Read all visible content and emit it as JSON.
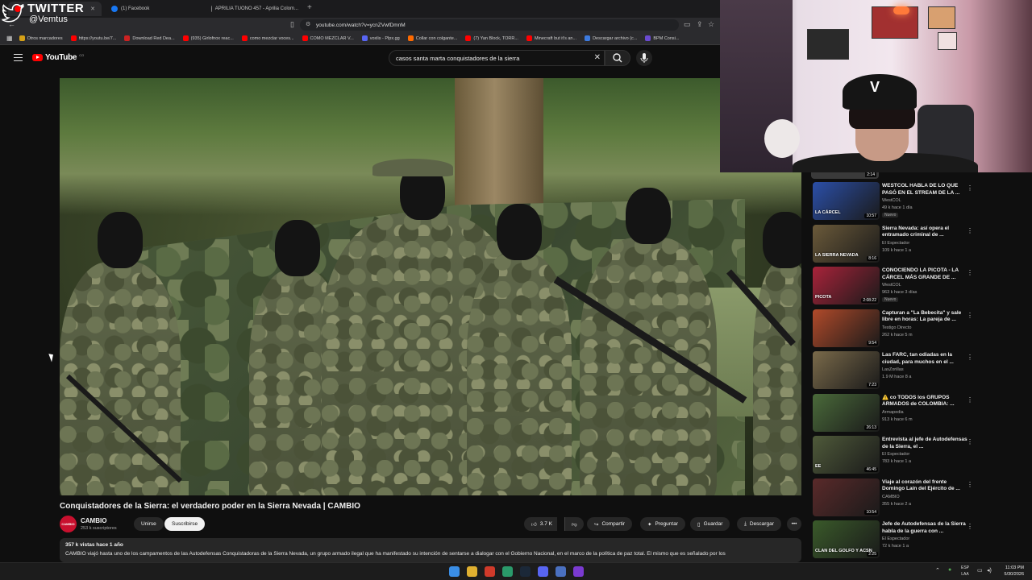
{
  "overlay": {
    "title": "TWITTER",
    "handle": "@Vemtus"
  },
  "browser": {
    "tabs": [
      {
        "label": "",
        "favicon_color": "#ff0000"
      },
      {
        "label": "(1) Facebook",
        "favicon_color": "#1877f2"
      },
      {
        "label": "APRILIA TUONO 457 - Aprilia Colom...",
        "favicon_color": "#888888"
      }
    ],
    "url": "youtube.com/watch?v=ycnZVwfDmnM",
    "bookmarks": [
      {
        "label": "Otros marcadores",
        "color": "#d4a017"
      },
      {
        "label": "https://youtu.be/7...",
        "color": "#ff0000"
      },
      {
        "label": "Download Red Dea...",
        "color": "#c22"
      },
      {
        "label": "(935) Girlofnox reac...",
        "color": "#ff0000"
      },
      {
        "label": "como mezclar voces...",
        "color": "#ff0000"
      },
      {
        "label": "COMO MEZCLAR V...",
        "color": "#ff0000"
      },
      {
        "label": "voxlis - Plpx.gg",
        "color": "#5865f2"
      },
      {
        "label": "Collar con colgante...",
        "color": "#ff6a00"
      },
      {
        "label": "(7) Yan Block, TORR...",
        "color": "#ff0000"
      },
      {
        "label": "Minecraft but it's an...",
        "color": "#ff0000"
      },
      {
        "label": "Descargar archivo (c...",
        "color": "#3d7be0"
      },
      {
        "label": "BPM Consi...",
        "color": "#6a4ad0"
      }
    ]
  },
  "youtube": {
    "logo_text": "YouTube",
    "logo_country": "CO",
    "search_query": "casos santa marta conquistadores de la sierra",
    "video": {
      "title": "Conquistadores de la Sierra: el verdadero poder en la Sierra Nevada | CAMBIO",
      "channel": "CAMBIO",
      "channel_avatar_text": "CAMBIO",
      "subscribers": "253 k suscriptores",
      "join_label": "Unirse",
      "subscribe_label": "Suscribirse",
      "likes": "3.7 K",
      "share_label": "Compartir",
      "ask_label": "Preguntar",
      "save_label": "Guardar",
      "download_label": "Descargar",
      "views_meta": "357 k vistas  hace 1 año",
      "description": "CAMBIO viajó hasta uno de los campamentos de las Autodefensas Conquistadoras de la Sierra Nevada, un grupo armado ilegal que ha manifestado su intención de sentarse a dialogar con el Gobierno Nacional, en el marco de la política de paz total. El mismo que es señalado por los"
    },
    "sidebar": {
      "top_partial_duration": "2:14",
      "items": [
        {
          "title": "WESTCOL HABLA DE LO QUE PASÓ EN EL STREAM DE LA ...",
          "channel": "WestCOL",
          "stats": "49 k  hace 1 día",
          "badge": "Nuevo",
          "duration": "10:57",
          "caption": "LA CÁRCEL",
          "thumb_color": "#2b4fa8"
        },
        {
          "title": "Sierra Nevada: así opera el entramado criminal de ...",
          "channel": "El Espectador",
          "stats": "109 k  hace 1 a",
          "badge": "",
          "duration": "8:16",
          "caption": "LA SIERRA NEVADA",
          "thumb_color": "#6b5a3a"
        },
        {
          "title": "CONOCIENDO LA PICOTA - LA CÁRCEL MÁS GRANDE DE ...",
          "channel": "WestCOL",
          "stats": "963 k  hace 3 días",
          "badge": "Nuevo",
          "duration": "2:08:22",
          "caption": "PICOTA",
          "thumb_color": "#a8233a"
        },
        {
          "title": "Capturan a \"La Bebecita\" y sale libre en horas: La pareja de ...",
          "channel": "Testigo Directo",
          "stats": "262 k  hace 5 m",
          "badge": "",
          "duration": "9:54",
          "caption": "",
          "thumb_color": "#b04a2a"
        },
        {
          "title": "Las FARC, tan odiadas en la ciudad, para muchos en el ...",
          "channel": "LasZorillas",
          "stats": "1.9 M  hace 8 a",
          "badge": "",
          "duration": "7:23",
          "caption": "",
          "thumb_color": "#7a6a4a"
        },
        {
          "title": "⚠️ co TODOS los GRUPOS ARMADOS de COLOMBIA: ...",
          "channel": "Armapedia",
          "stats": "913 k  hace 6 m",
          "badge": "",
          "duration": "26:13",
          "caption": "",
          "thumb_color": "#4a6a3a"
        },
        {
          "title": "Entrevista al jefe de Autodefensas de la Sierra, el ...",
          "channel": "El Espectador",
          "stats": "783 k  hace 1 a",
          "badge": "",
          "duration": "46:45",
          "caption": "EE",
          "thumb_color": "#4f5a3a"
        },
        {
          "title": "Viaje al corazón del frente Domingo Laín del Ejército de ...",
          "channel": "CAMBIO",
          "stats": "355 k  hace 2 a",
          "badge": "",
          "duration": "10:54",
          "caption": "",
          "thumb_color": "#5a2a2a"
        },
        {
          "title": "Jefe de Autodefensas de la Sierra habla de la guerra con ...",
          "channel": "El Espectador",
          "stats": "72 k  hace 1 a",
          "badge": "",
          "duration": "2:25",
          "caption": "CLAN DEL GOLFO Y ACSN",
          "thumb_color": "#3a5a2a"
        }
      ]
    }
  },
  "taskbar": {
    "language_top": "ESP",
    "language_bottom": "LAA",
    "time": "11:03 PM",
    "date": "5/30/2026"
  }
}
